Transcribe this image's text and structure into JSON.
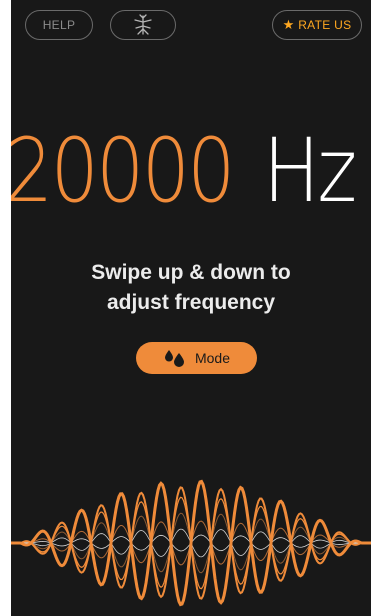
{
  "header": {
    "help_label": "HELP",
    "mosquito_icon": "mosquito-icon",
    "rate_label": "RATE US",
    "rate_icon": "star-icon"
  },
  "frequency": {
    "value": "20000",
    "unit": "Hz"
  },
  "instruction": {
    "line1": "Swipe up & down to",
    "line2": "adjust frequency"
  },
  "mode_button": {
    "label": "Mode",
    "icon": "drops-icon"
  },
  "colors": {
    "accent": "#ef8b3a",
    "background": "#181818",
    "rate_accent": "#ffa820",
    "text": "#ececec"
  }
}
